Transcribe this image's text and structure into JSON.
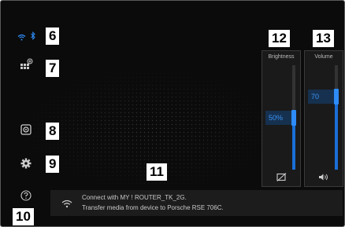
{
  "status": {
    "wifi_icon": "wifi-icon",
    "bluetooth_icon": "bluetooth-icon"
  },
  "sidebar": {
    "items": [
      {
        "name": "network-icon"
      },
      {
        "name": "media-icon"
      },
      {
        "name": "settings-icon"
      },
      {
        "name": "help-icon"
      }
    ]
  },
  "callouts": [
    "6",
    "7",
    "8",
    "9",
    "10",
    "11",
    "12",
    "13"
  ],
  "brightness": {
    "title": "Brightness",
    "value": "50%",
    "level": 0.5,
    "icon": "brightness-icon"
  },
  "volume": {
    "title": "Volume",
    "value": "70",
    "level": 0.7,
    "icon": "speaker-icon"
  },
  "notification": {
    "line1": "Connect with MY ! ROUTER_TK_2G.",
    "line2": "Transfer media from device to Porsche RSE 706C.",
    "icon": "wifi-icon"
  },
  "colors": {
    "accent": "#2d8cf7",
    "background": "#0b0b0b",
    "panel": "#1a1a1a"
  }
}
